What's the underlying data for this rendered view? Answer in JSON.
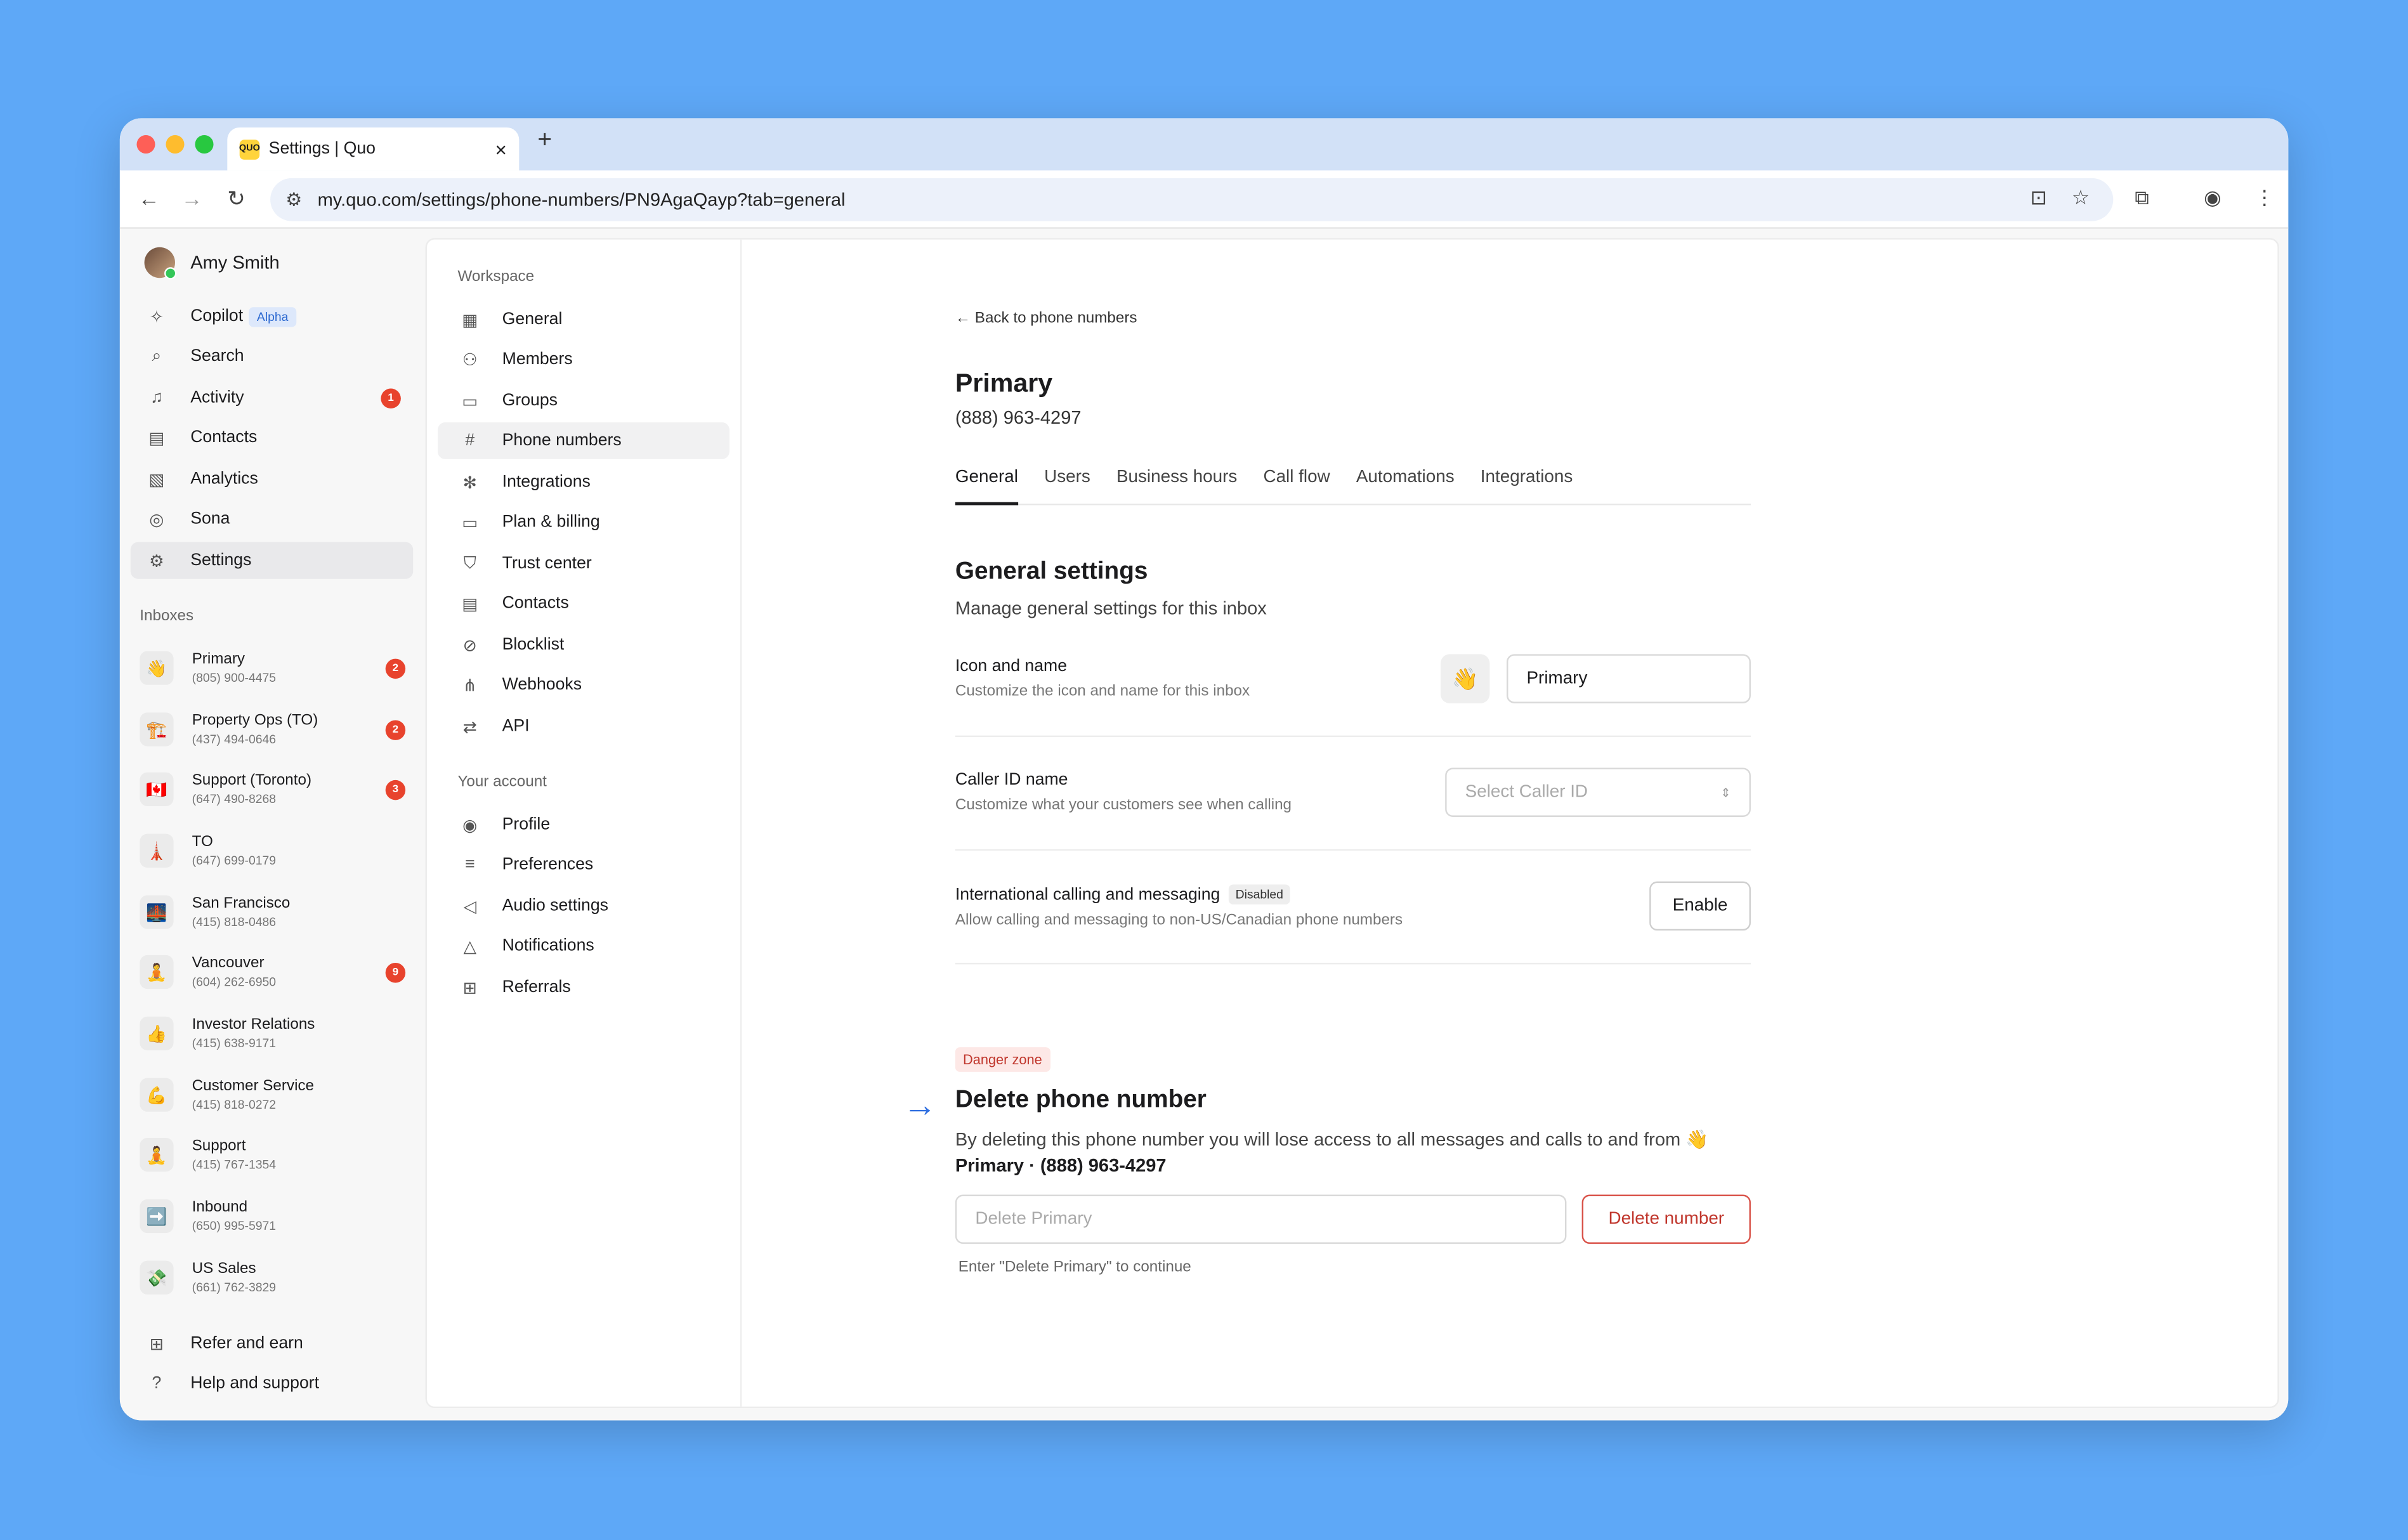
{
  "browser": {
    "tab_title": "Settings | Quo",
    "tab_favicon": "QUO",
    "url": "my.quo.com/settings/phone-numbers/PN9AgaQayp?tab=general",
    "new_tab": "+",
    "close_tab": "×"
  },
  "sidebar": {
    "user_name": "Amy Smith",
    "nav": [
      {
        "label": "Copilot",
        "icon": "sparkle-icon",
        "tag": "Alpha"
      },
      {
        "label": "Search",
        "icon": "search-icon"
      },
      {
        "label": "Activity",
        "icon": "bell-icon",
        "badge": "1"
      },
      {
        "label": "Contacts",
        "icon": "contacts-icon"
      },
      {
        "label": "Analytics",
        "icon": "analytics-icon"
      },
      {
        "label": "Sona",
        "icon": "sona-icon"
      },
      {
        "label": "Settings",
        "icon": "gear-icon",
        "active": true
      }
    ],
    "inboxes_label": "Inboxes",
    "inboxes": [
      {
        "name": "Primary",
        "phone": "(805) 900-4475",
        "emoji": "👋",
        "badge": "2"
      },
      {
        "name": "Property Ops (TO)",
        "phone": "(437) 494-0646",
        "emoji": "🏗️",
        "badge": "2"
      },
      {
        "name": "Support (Toronto)",
        "phone": "(647) 490-8268",
        "emoji": "🇨🇦",
        "badge": "3"
      },
      {
        "name": "TO",
        "phone": "(647) 699-0179",
        "emoji": "🗼"
      },
      {
        "name": "San Francisco",
        "phone": "(415) 818-0486",
        "emoji": "🌉"
      },
      {
        "name": "Vancouver",
        "phone": "(604) 262-6950",
        "emoji": "🧘",
        "badge": "9"
      },
      {
        "name": "Investor Relations",
        "phone": "(415) 638-9171",
        "emoji": "👍"
      },
      {
        "name": "Customer Service",
        "phone": "(415) 818-0272",
        "emoji": "💪"
      },
      {
        "name": "Support",
        "phone": "(415) 767-1354",
        "emoji": "🧘"
      },
      {
        "name": "Inbound",
        "phone": "(650) 995-5971",
        "emoji": "➡️"
      },
      {
        "name": "US Sales",
        "phone": "(661) 762-3829",
        "emoji": "💸"
      }
    ],
    "footer": [
      {
        "label": "Refer and earn",
        "icon": "gift-icon"
      },
      {
        "label": "Help and support",
        "icon": "help-icon"
      }
    ]
  },
  "settings_nav": {
    "workspace_label": "Workspace",
    "workspace": [
      {
        "label": "General",
        "icon": "building-icon"
      },
      {
        "label": "Members",
        "icon": "members-icon"
      },
      {
        "label": "Groups",
        "icon": "folder-icon"
      },
      {
        "label": "Phone numbers",
        "icon": "hash-icon",
        "active": true
      },
      {
        "label": "Integrations",
        "icon": "integrations-icon"
      },
      {
        "label": "Plan & billing",
        "icon": "card-icon"
      },
      {
        "label": "Trust center",
        "icon": "shield-icon"
      },
      {
        "label": "Contacts",
        "icon": "contacts-icon"
      },
      {
        "label": "Blocklist",
        "icon": "block-icon"
      },
      {
        "label": "Webhooks",
        "icon": "webhook-icon"
      },
      {
        "label": "API",
        "icon": "api-icon"
      }
    ],
    "account_label": "Your account",
    "account": [
      {
        "label": "Profile",
        "icon": "profile-icon"
      },
      {
        "label": "Preferences",
        "icon": "sliders-icon"
      },
      {
        "label": "Audio settings",
        "icon": "speaker-icon"
      },
      {
        "label": "Notifications",
        "icon": "bell-icon"
      },
      {
        "label": "Referrals",
        "icon": "gift-icon"
      }
    ]
  },
  "main": {
    "back_link": "Back to phone numbers",
    "title": "Primary",
    "number": "(888) 963-4297",
    "tabs": [
      "General",
      "Users",
      "Business hours",
      "Call flow",
      "Automations",
      "Integrations"
    ],
    "section_title": "General settings",
    "section_subtitle": "Manage general settings for this inbox",
    "icon_name": {
      "title": "Icon and name",
      "desc": "Customize the icon and name for this inbox",
      "emoji": "👋",
      "value": "Primary"
    },
    "caller_id": {
      "title": "Caller ID name",
      "desc": "Customize what your customers see when calling",
      "placeholder": "Select Caller ID"
    },
    "international": {
      "title": "International calling and messaging",
      "status": "Disabled",
      "desc": "Allow calling and messaging to non-US/Canadian phone numbers",
      "button": "Enable"
    },
    "danger": {
      "tag": "Danger zone",
      "title": "Delete phone number",
      "desc_start": "By deleting this phone number you will lose access to all messages and calls to and from",
      "desc_target": "👋 Primary · (888) 963-4297",
      "input_placeholder": "Delete Primary",
      "button": "Delete number",
      "hint": "Enter \"Delete Primary\" to continue"
    }
  },
  "colors": {
    "background": "#5ea8f7",
    "badge": "#e8432d",
    "danger": "#c0362c",
    "accent": "#2f6fe0"
  }
}
